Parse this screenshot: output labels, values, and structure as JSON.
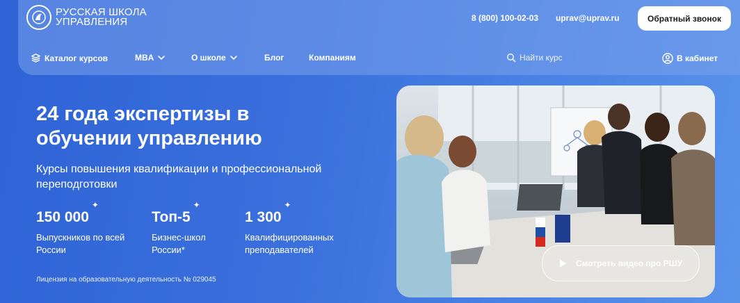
{
  "header": {
    "logo_line1": "РУССКАЯ ШКОЛА",
    "logo_line2": "УПРАВЛЕНИЯ",
    "phone": "8 (800) 100-02-03",
    "email": "uprav@uprav.ru",
    "callback_label": "Обратный звонок"
  },
  "nav": {
    "catalog": "Каталог курсов",
    "mba": "MBA",
    "about": "О школе",
    "blog": "Блог",
    "companies": "Компаниям",
    "search": "Найти курс",
    "cabinet": "В кабинет"
  },
  "hero": {
    "title": "24 года экспертизы в обучении управлению",
    "subtitle": "Курсы повышения квалификации и профессиональной переподготовки",
    "stats": [
      {
        "value": "150 000",
        "label": "Выпускников по всей России"
      },
      {
        "value": "Топ-5",
        "label": "Бизнес-школ России*"
      },
      {
        "value": "1 300",
        "label": "Квалифицированных преподавателей"
      }
    ],
    "license": "Лицензия на образовательную деятельность № 029045",
    "video_label": "Смотреть видео про РШУ"
  },
  "icons": {
    "sparkle": "✦",
    "catalog": "layers-icon",
    "chevron": "chevron-down-icon",
    "search": "search-icon",
    "user": "user-icon",
    "play": "play-icon"
  },
  "colors": {
    "background": "#3a6fdc",
    "callback_bg": "#ffffff"
  }
}
